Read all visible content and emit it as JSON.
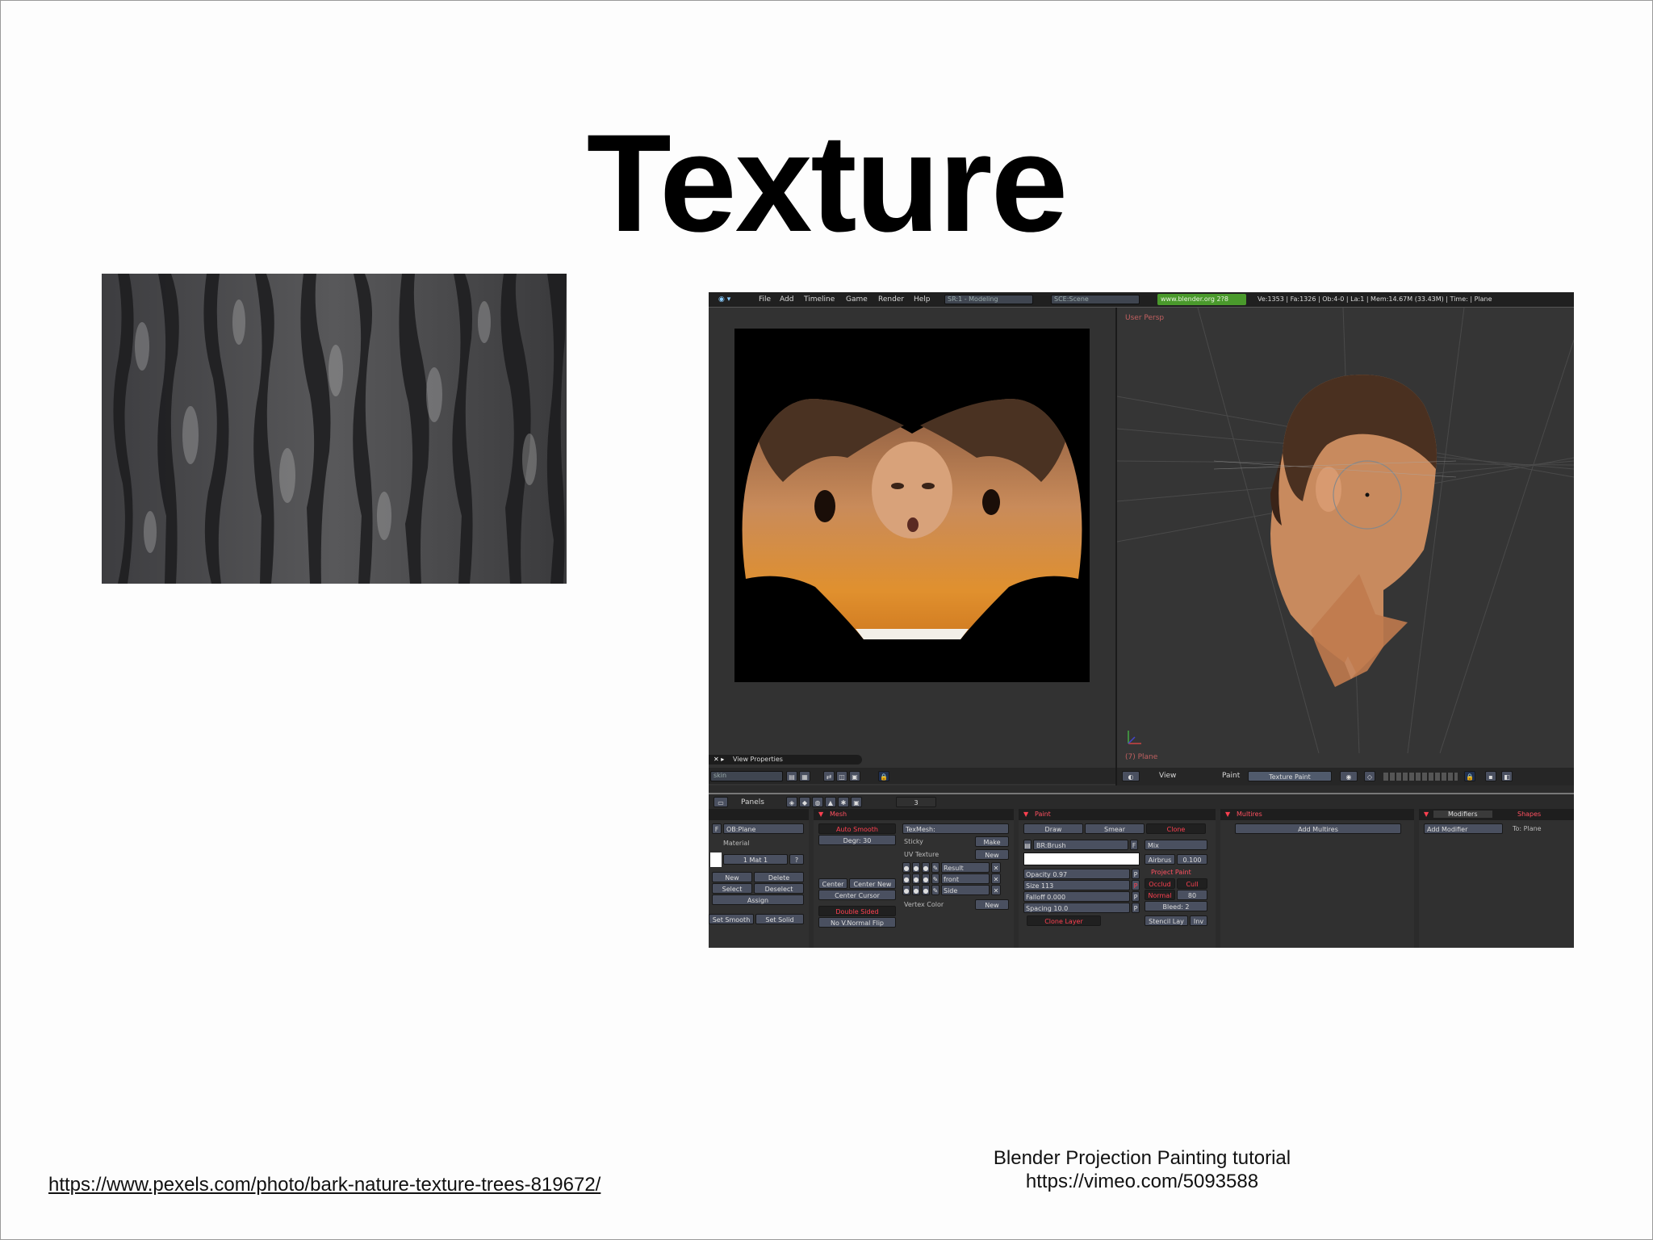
{
  "slide": {
    "title": "Texture",
    "credit_left": "https://www.pexels.com/photo/bark-nature-texture-trees-819672/",
    "credit_right_line1": "Blender Projection Painting tutorial",
    "credit_right_line2": "https://vimeo.com/5093588"
  },
  "blender": {
    "menu": [
      "File",
      "Add",
      "Timeline",
      "Game",
      "Render",
      "Help"
    ],
    "screen_field": "SR:1 - Modeling",
    "scene_field": "SCE:Scene",
    "url_badge": "www.blender.org 2?8",
    "stats": "Ve:1353 | Fa:1326 | Ob:4-0 | La:1  | Mem:14.67M (33.43M)  | Time: | Plane",
    "viewport_label": "User Persp",
    "object_label": "(7) Plane",
    "uv_footer_view_props": "View Properties",
    "uv_footer_image": "skin",
    "view3d_view": "View",
    "view3d_paint": "Paint",
    "view3d_mode": "Texture Paint",
    "buttons_panels": "Panels",
    "buttons_frame": "3",
    "panel_titles": [
      "Mesh",
      "Paint",
      "Multires",
      "Modifiers",
      "Shapes"
    ],
    "link_panel": {
      "ob": "OB:Plane",
      "material": "Material",
      "mat": "1 Mat 1",
      "new": "New",
      "delete": "Delete",
      "select": "Select",
      "deselect": "Deselect",
      "assign": "Assign",
      "set_smooth": "Set Smooth",
      "set_solid": "Set Solid"
    },
    "mesh_panel": {
      "auto_smooth": "Auto Smooth",
      "degr": "Degr: 30",
      "texmesh": "TexMesh:",
      "sticky": "Sticky",
      "make": "Make",
      "uv_texture": "UV Texture",
      "new": "New",
      "layers": [
        "Result",
        "front",
        "Side"
      ],
      "vertex_color": "Vertex Color",
      "vc_new": "New",
      "center": "Center",
      "center_new": "Center New",
      "center_cursor": "Center Cursor",
      "double_sided": "Double Sided",
      "no_v_normal_flip": "No V.Normal Flip"
    },
    "paint_panel": {
      "modes": [
        "Draw",
        "Smear",
        "Clone"
      ],
      "brush": "BR:Brush",
      "blend": "Mix",
      "airbrush": "Airbrus",
      "airbrush_val": "0.100",
      "opacity": "Opacity 0.97",
      "size": "Size 113",
      "falloff": "Falloff 0.000",
      "spacing": "Spacing 10.0",
      "project_paint": "Project Paint",
      "occlude": "Occlud",
      "cull": "Cull",
      "normal": "Normal",
      "normal_val": "80",
      "bleed": "Bleed: 2",
      "stencil": "Stencil Lay",
      "inv": "Inv",
      "clone_layer": "Clone Layer"
    },
    "multires_panel": {
      "add": "Add Multires"
    },
    "modifiers_panel": {
      "add": "Add Modifier",
      "to": "To: Plane"
    }
  }
}
